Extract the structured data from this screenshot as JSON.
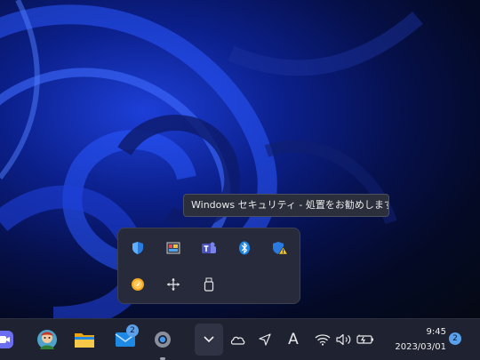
{
  "tooltip": {
    "text": "Windows セキュリティ - 処置をお勧めします。"
  },
  "tray_overflow": {
    "items": [
      {
        "name": "windows-security-shield-icon"
      },
      {
        "name": "display-adapter-icon"
      },
      {
        "name": "teams-icon"
      },
      {
        "name": "bluetooth-icon"
      },
      {
        "name": "windows-security-warning-icon"
      },
      {
        "name": "update-orange-icon"
      },
      {
        "name": "move-arrows-icon"
      },
      {
        "name": "usb-drive-icon"
      }
    ]
  },
  "taskbar": {
    "mail_badge": "2",
    "ime_label": "A",
    "time": "9:45",
    "date": "2023/03/01",
    "notification_count": "2"
  },
  "colors": {
    "accent": "#5aa0ea",
    "taskbar": "#1f2230",
    "flyout": "#262a3a"
  }
}
